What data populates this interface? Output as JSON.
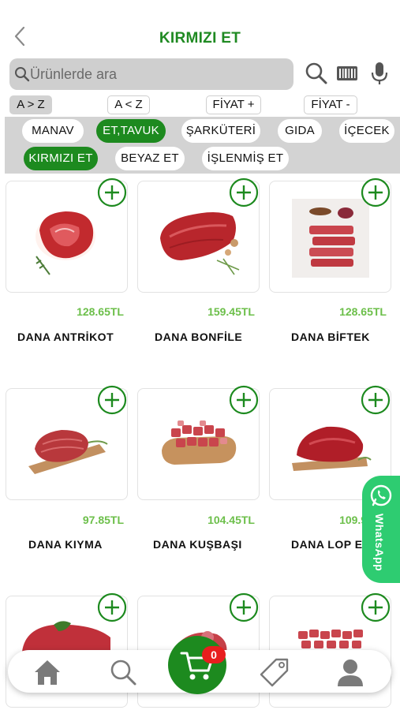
{
  "header": {
    "title": "KIRMIZI ET"
  },
  "search": {
    "placeholder": "Ürünlerde ara"
  },
  "sort_options": [
    {
      "label": "A > Z",
      "active": true
    },
    {
      "label": "A < Z",
      "active": false
    },
    {
      "label": "FİYAT +",
      "active": false
    },
    {
      "label": "FİYAT -",
      "active": false
    }
  ],
  "categories": [
    {
      "label": "MANAV",
      "active": false
    },
    {
      "label": "ET,TAVUK",
      "active": true
    },
    {
      "label": "ŞARKÜTERİ",
      "active": false
    },
    {
      "label": "GIDA",
      "active": false
    },
    {
      "label": "İÇECEK",
      "active": false
    },
    {
      "label": "KIRMIZI ET",
      "active": true
    },
    {
      "label": "BEYAZ ET",
      "active": false
    },
    {
      "label": "İŞLENMİŞ ET",
      "active": false
    }
  ],
  "products": [
    {
      "name": "DANA ANTRİKOT",
      "price": "128.65TL"
    },
    {
      "name": "DANA BONFİLE",
      "price": "159.45TL"
    },
    {
      "name": "DANA BİFTEK",
      "price": "128.65TL"
    },
    {
      "name": "DANA KIYMA",
      "price": "97.85TL"
    },
    {
      "name": "DANA KUŞBAŞI",
      "price": "104.45TL"
    },
    {
      "name": "DANA LOP ET",
      "price": "109.95TL"
    },
    {
      "name": "",
      "price": ""
    },
    {
      "name": "",
      "price": ""
    },
    {
      "name": "",
      "price": ""
    }
  ],
  "whatsapp": {
    "label": "WhatsApp"
  },
  "cart": {
    "count": "0"
  },
  "colors": {
    "brand_green": "#1d8a1f",
    "price_green": "#6cbf4a",
    "whatsapp_green": "#2ecc71",
    "badge_red": "#e81e1e",
    "panel_gray": "#d3d3d3"
  },
  "icons": {
    "back": "chevron-left-icon",
    "search": "search-icon",
    "barcode": "barcode-icon",
    "mic": "microphone-icon",
    "add": "plus-circle-icon",
    "home": "home-icon",
    "tag": "tag-icon",
    "profile": "user-icon",
    "cart": "cart-icon",
    "whatsapp": "whatsapp-icon"
  }
}
